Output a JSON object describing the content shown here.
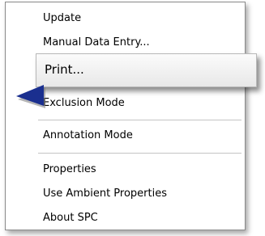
{
  "context_menu": {
    "items": [
      {
        "label": "Update"
      },
      {
        "label": "Manual Data Entry..."
      },
      {
        "label": "Print..."
      },
      {
        "label": "Exclusion Mode"
      },
      {
        "label": "Annotation Mode"
      },
      {
        "label": "Properties"
      },
      {
        "label": "Use Ambient Properties"
      },
      {
        "label": "About SPC"
      }
    ],
    "highlighted_index": 2
  },
  "pointer": {
    "icon": "arrow-left-icon",
    "color": "#1a2f8f"
  }
}
